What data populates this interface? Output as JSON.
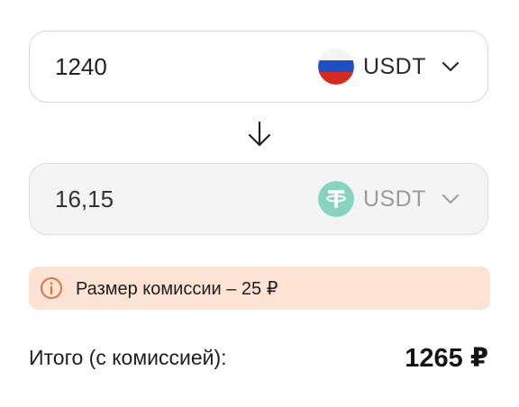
{
  "from": {
    "amount": "1240",
    "currency": "USDT",
    "flag_icon": "russia-flag-icon"
  },
  "to": {
    "amount": "16,15",
    "currency": "USDT",
    "coin_icon": "tether-icon",
    "coin_color": "#83d4c0"
  },
  "direction_icon": "arrow-down-icon",
  "fee_notice": {
    "icon": "info-icon",
    "text": "Размер комиссии – 25 ₽",
    "background": "#fde3d3",
    "icon_color": "#d9763d"
  },
  "total": {
    "label": "Итого (с комиссией):",
    "value": "1265 ₽"
  }
}
